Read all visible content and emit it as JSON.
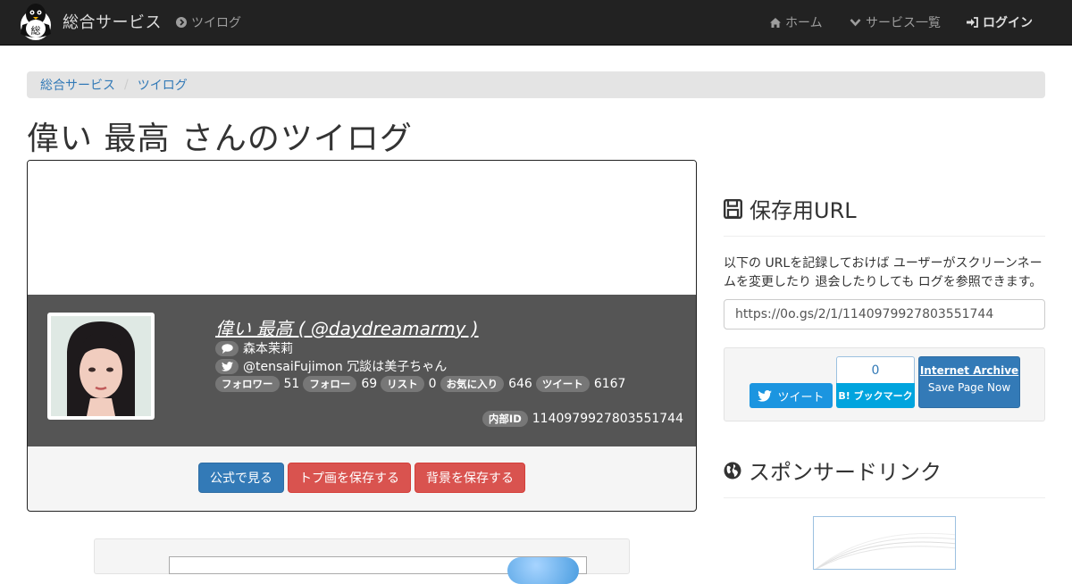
{
  "nav": {
    "brand": "総合サービス",
    "tweetlog": "ツイログ",
    "home": "ホーム",
    "services": "サービス一覧",
    "login": "ログイン"
  },
  "breadcrumb": [
    "総合サービス",
    "ツイログ"
  ],
  "page_title": "偉い 最高 さんのツイログ",
  "profile": {
    "display_name": "偉い 最高 ( @daydreamarmy )",
    "bio": "森本茉莉",
    "twitter_line": "@tensaiFujimon 冗談は美子ちゃん",
    "stats": [
      {
        "label": "フォロワー",
        "value": "51"
      },
      {
        "label": "フォロー",
        "value": "69"
      },
      {
        "label": "リスト",
        "value": "0"
      },
      {
        "label": "お気に入り",
        "value": "646"
      },
      {
        "label": "ツイート",
        "value": "6167"
      }
    ],
    "internal_id_label": "内部ID",
    "internal_id": "1140979927803551744"
  },
  "actions": {
    "official": "公式で見る",
    "save_top": "トプ画を保存する",
    "save_bg": "背景を保存する"
  },
  "sidebar": {
    "save_url_title": "保存用URL",
    "save_url_desc": "以下の URLを記録しておけば ユーザーがスクリーンネームを変更したり 退会したりしても ログを参照できます。",
    "save_url_value": "https://0o.gs/2/1/1140979927803551744",
    "tweet_button": "ツイート",
    "hatena_count": "0",
    "hatena_button": "B! ブックマーク",
    "ia_title": "Internet Archive",
    "ia_sub": "Save Page Now",
    "sponsored_title": "スポンサードリンク"
  },
  "colors": {
    "navbar": "#222222",
    "primary": "#337ab7",
    "danger": "#d9534f",
    "profile_bg": "#555555",
    "twitter": "#1b95e0",
    "hatena": "#00a4de"
  }
}
